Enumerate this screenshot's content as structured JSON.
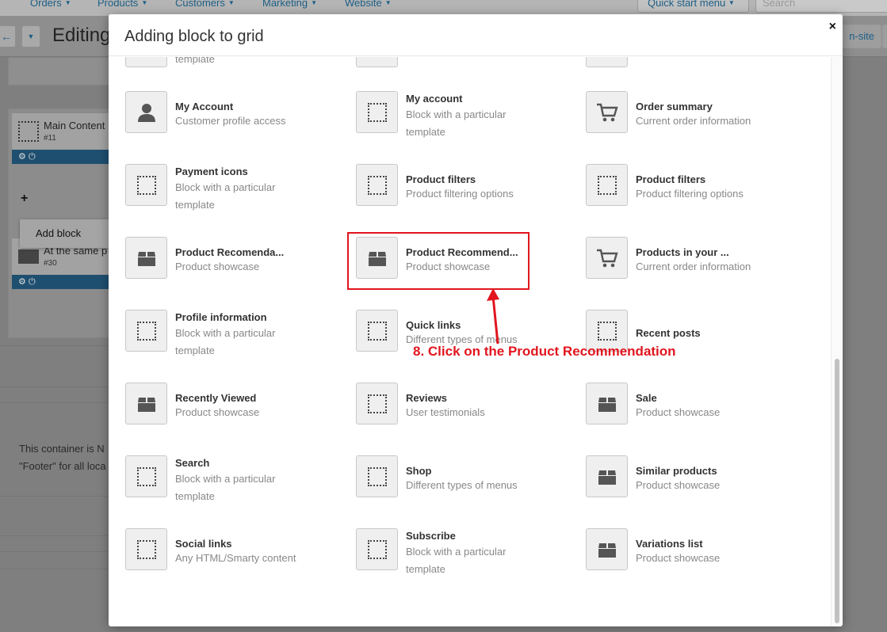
{
  "background": {
    "nav_items": [
      "Orders",
      "Products",
      "Customers",
      "Marketing",
      "Website"
    ],
    "quick_start": "Quick start menu",
    "search_placeholder": "Search",
    "page_title": "Editing",
    "on_site_label": "n-site",
    "blocks": [
      {
        "title": "Main Content",
        "id": "#11"
      },
      {
        "title": "At the same p",
        "id": "#30"
      }
    ],
    "add_block": "Add block",
    "note_lines": [
      "This container is N",
      "\"Footer\" for all loca"
    ]
  },
  "modal": {
    "title": "Adding block to grid",
    "close": "×",
    "partial_top_desc": "template",
    "tiles": [
      {
        "name": "My Account",
        "desc": "Customer profile access",
        "icon": "user-icon"
      },
      {
        "name": "My account",
        "desc": "Block with a particular template",
        "icon": "dotted-block-icon"
      },
      {
        "name": "Order summary",
        "desc": "Current order information",
        "icon": "cart-icon"
      },
      {
        "name": "Payment icons",
        "desc": "Block with a particular template",
        "icon": "dotted-block-icon"
      },
      {
        "name": "Product filters",
        "desc": "Product filtering options",
        "icon": "dotted-block-icon"
      },
      {
        "name": "Product filters",
        "desc": "Product filtering options",
        "icon": "dotted-block-icon"
      },
      {
        "name": "Product Recomenda...",
        "desc": "Product showcase",
        "icon": "box-icon"
      },
      {
        "name": "Product Recommend...",
        "desc": "Product showcase",
        "icon": "box-icon"
      },
      {
        "name": "Products in your ...",
        "desc": "Current order information",
        "icon": "cart-icon"
      },
      {
        "name": "Profile information",
        "desc": "Block with a particular template",
        "icon": "dotted-block-icon"
      },
      {
        "name": "Quick links",
        "desc": "Different types of menus",
        "icon": "dotted-block-icon"
      },
      {
        "name": "Recent posts",
        "desc": "",
        "icon": "dotted-block-icon"
      },
      {
        "name": "Recently Viewed",
        "desc": "Product showcase",
        "icon": "box-icon"
      },
      {
        "name": "Reviews",
        "desc": "User testimonials",
        "icon": "dotted-block-icon"
      },
      {
        "name": "Sale",
        "desc": "Product showcase",
        "icon": "box-icon"
      },
      {
        "name": "Search",
        "desc": "Block with a particular template",
        "icon": "dotted-block-icon"
      },
      {
        "name": "Shop",
        "desc": "Different types of menus",
        "icon": "dotted-block-icon"
      },
      {
        "name": "Similar products",
        "desc": "Product showcase",
        "icon": "box-icon"
      },
      {
        "name": "Social links",
        "desc": "Any HTML/Smarty content",
        "icon": "dotted-block-icon"
      },
      {
        "name": "Subscribe",
        "desc": "Block with a particular template",
        "icon": "dotted-block-icon"
      },
      {
        "name": "Variations list",
        "desc": "Product showcase",
        "icon": "box-icon"
      }
    ]
  },
  "annotation": {
    "text": "8. Click on the Product Recommendation",
    "color": "#e1151e"
  }
}
